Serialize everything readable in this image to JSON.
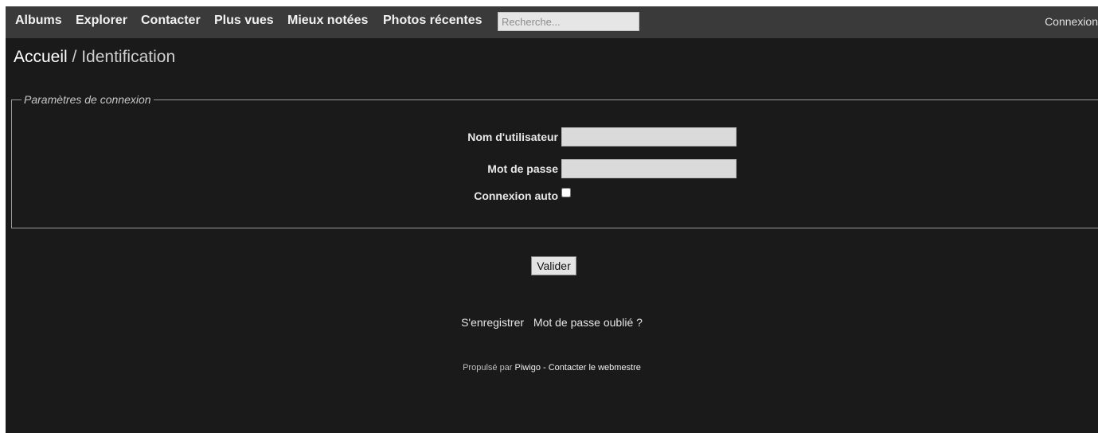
{
  "menubar": {
    "items": [
      {
        "label": "Albums"
      },
      {
        "label": "Explorer"
      },
      {
        "label": "Contacter"
      },
      {
        "label": "Plus vues"
      },
      {
        "label": "Mieux notées"
      },
      {
        "label": "Photos récentes"
      }
    ],
    "search_placeholder": "Recherche...",
    "login_label": "Connexion"
  },
  "breadcrumb": {
    "home": "Accueil",
    "separator": " / ",
    "current": "Identification"
  },
  "login_form": {
    "legend": "Paramètres de connexion",
    "username_label": "Nom d'utilisateur",
    "password_label": "Mot de passe",
    "remember_label": "Connexion auto",
    "username_value": "",
    "password_value": "",
    "remember_checked": false,
    "submit_label": "Valider"
  },
  "links": {
    "register": "S'enregistrer",
    "forgot_password": "Mot de passe oublié ?"
  },
  "footer": {
    "powered_prefix": "Propulsé par ",
    "piwigo": "Piwigo",
    "separator": " - ",
    "contact": "Contacter le webmestre"
  },
  "colors": {
    "background": "#1a1a1a",
    "menubar": "#3a3a3a",
    "text": "#f2f2f2"
  }
}
